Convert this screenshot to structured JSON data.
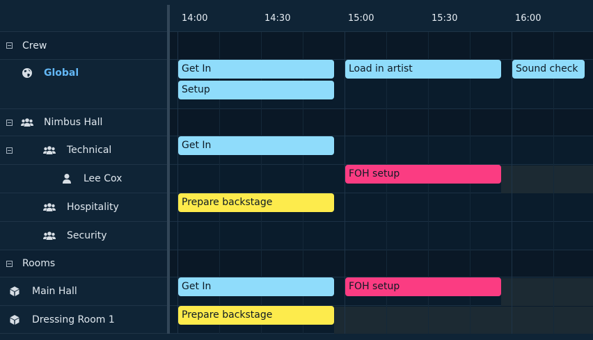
{
  "colors": {
    "blue": "#8fdcfb",
    "pink": "#fb3c82",
    "yellow": "#fdeb4c",
    "accent": "#63b7f5"
  },
  "timeline": {
    "ticks": [
      "14:00",
      "14:30",
      "15:00",
      "15:30",
      "16:00"
    ]
  },
  "rows": {
    "crew": {
      "label": "Crew"
    },
    "global": {
      "label": "Global"
    },
    "nimbus": {
      "label": "Nimbus Hall"
    },
    "technical": {
      "label": "Technical"
    },
    "leecox": {
      "label": "Lee Cox"
    },
    "hospitality": {
      "label": "Hospitality"
    },
    "security": {
      "label": "Security"
    },
    "rooms": {
      "label": "Rooms"
    },
    "mainhall": {
      "label": "Main Hall"
    },
    "dressing": {
      "label": "Dressing Room 1"
    }
  },
  "events": {
    "global_getin": "Get In",
    "global_loadin": "Load in artist",
    "global_soundcheck": "Sound check",
    "global_setup": "Setup",
    "technical_getin": "Get In",
    "leecox_foh": "FOH setup",
    "hospitality_prepare": "Prepare backstage",
    "mainhall_getin": "Get In",
    "mainhall_foh": "FOH setup",
    "dressing_prepare": "Prepare backstage"
  }
}
